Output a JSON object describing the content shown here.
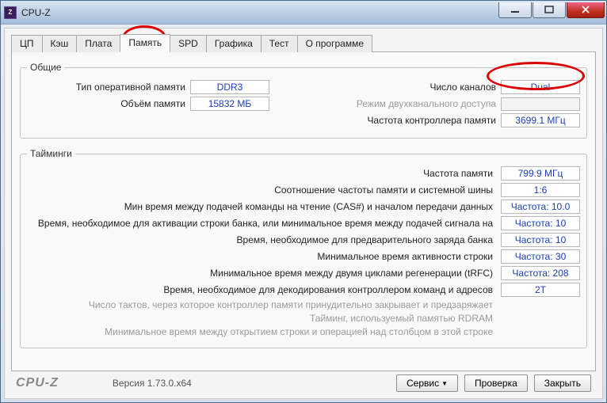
{
  "window": {
    "title": "CPU-Z"
  },
  "tabs": {
    "cpu": "ЦП",
    "cache": "Кэш",
    "board": "Плата",
    "memory": "Память",
    "spd": "SPD",
    "graphics": "Графика",
    "test": "Тест",
    "about": "О программе",
    "active": "memory"
  },
  "groups": {
    "general": "Общие",
    "timings": "Тайминги"
  },
  "general": {
    "type_label": "Тип оперативной памяти",
    "type_value": "DDR3",
    "channels_label": "Число каналов",
    "channels_value": "Dual",
    "size_label": "Объём памяти",
    "size_value": "15832 МБ",
    "dc_mode_label": "Режим двухканального доступа",
    "dc_mode_value": "",
    "nb_freq_label": "Частота контроллера памяти",
    "nb_freq_value": "3699.1 МГц"
  },
  "timings": {
    "items": [
      {
        "label": "Частота памяти",
        "value": "799.9 МГц"
      },
      {
        "label": "Соотношение частоты памяти и системной шины",
        "value": "1:6"
      },
      {
        "label": "Мин время между подачей команды на чтение (CAS#) и началом передачи данных",
        "value": "Частота: 10.0"
      },
      {
        "label": "Время, необходимое для активации строки банка, или минимальное время между подачей сигнала на",
        "value": "Частота: 10"
      },
      {
        "label": "Время, необходимое для предварительного заряда банка",
        "value": "Частота: 10"
      },
      {
        "label": "Минимальное время активности строки",
        "value": "Частота: 30"
      },
      {
        "label": "Минимальное время между двумя циклами регенерации (tRFC)",
        "value": "Частота: 208"
      },
      {
        "label": "Время, необходимое для декодирования контроллером команд и адресов",
        "value": "2T"
      }
    ],
    "disabled": [
      "Число тактов, через которое контроллер памяти принудительно закрывает и предзаряжает",
      "Тайминг, используемый памятью RDRAM",
      "Минимальное время между открытием строки и операцией над столбцом в этой строке"
    ]
  },
  "footer": {
    "brand": "CPU-Z",
    "version": "Версия 1.73.0.x64",
    "tools": "Сервис",
    "validate": "Проверка",
    "close": "Закрыть"
  }
}
